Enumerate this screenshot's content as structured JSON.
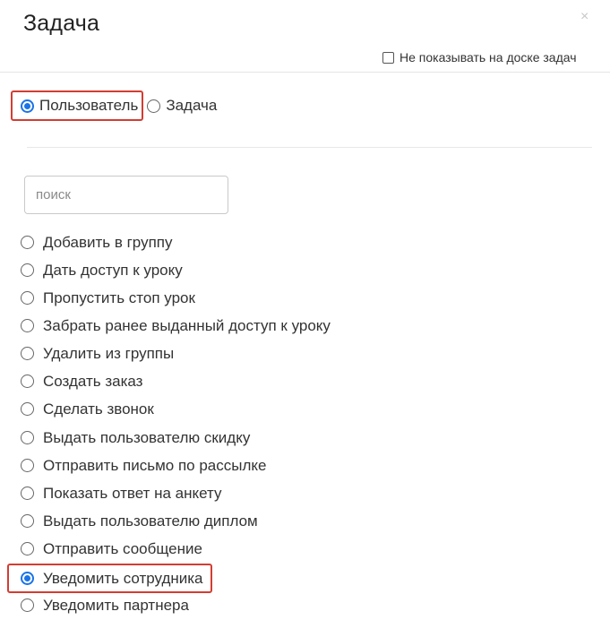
{
  "dialog": {
    "title": "Задача",
    "close_glyph": "×",
    "hide_on_board_label": "Не показывать на доске задач"
  },
  "type_selector": {
    "options": [
      {
        "label": "Пользователь",
        "selected": true
      },
      {
        "label": "Задача",
        "selected": false
      }
    ]
  },
  "search": {
    "placeholder": "поиск",
    "value": ""
  },
  "actions": [
    {
      "label": "Добавить в группу",
      "selected": false
    },
    {
      "label": "Дать доступ к уроку",
      "selected": false
    },
    {
      "label": "Пропустить стоп урок",
      "selected": false
    },
    {
      "label": "Забрать ранее выданный доступ к уроку",
      "selected": false
    },
    {
      "label": "Удалить из группы",
      "selected": false
    },
    {
      "label": "Создать заказ",
      "selected": false
    },
    {
      "label": "Сделать звонок",
      "selected": false
    },
    {
      "label": "Выдать пользователю скидку",
      "selected": false
    },
    {
      "label": "Отправить письмо по рассылке",
      "selected": false
    },
    {
      "label": "Показать ответ на анкету",
      "selected": false
    },
    {
      "label": "Выдать пользователю диплом",
      "selected": false
    },
    {
      "label": "Отправить сообщение",
      "selected": false
    },
    {
      "label": "Уведомить сотрудника",
      "selected": true
    },
    {
      "label": "Уведомить партнера",
      "selected": false
    }
  ],
  "colors": {
    "accent": "#1a73e8",
    "highlight_border": "#d33d32"
  }
}
